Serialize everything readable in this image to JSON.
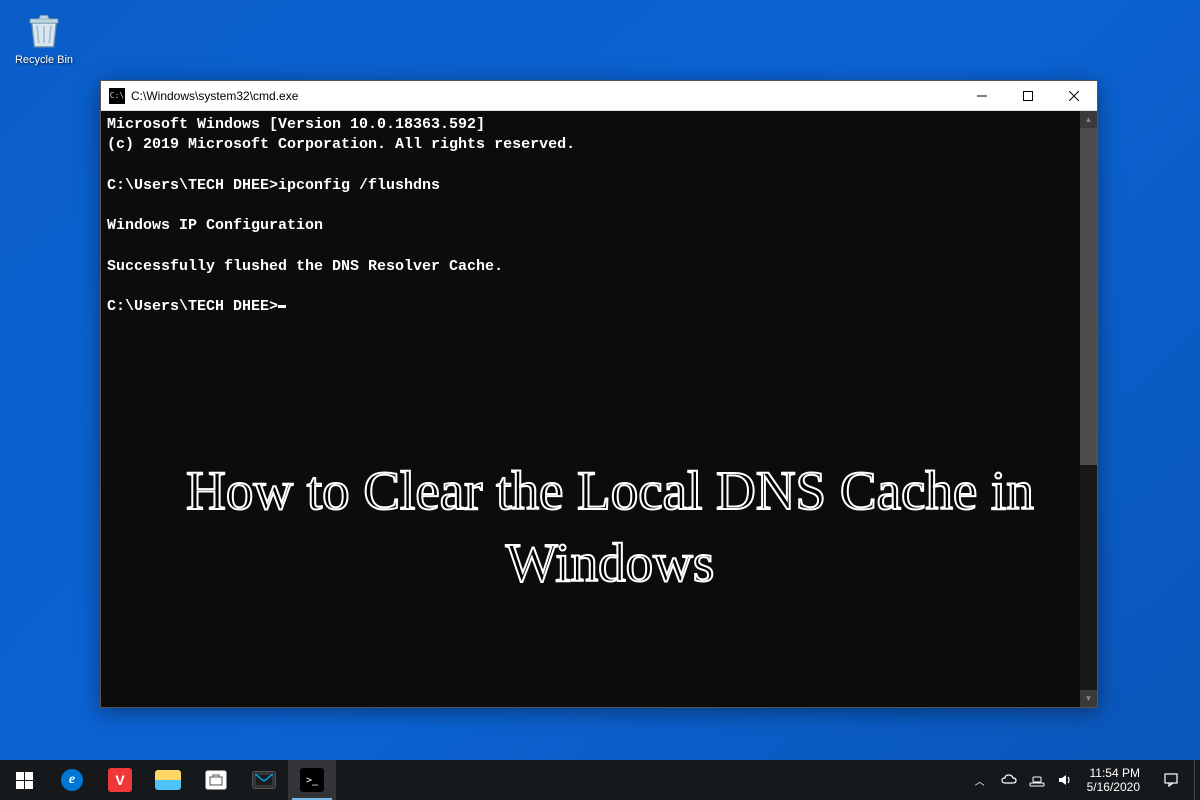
{
  "desktop": {
    "recycle_bin_label": "Recycle Bin"
  },
  "cmd": {
    "title": "C:\\Windows\\system32\\cmd.exe",
    "lines": {
      "version": "Microsoft Windows [Version 10.0.18363.592]",
      "copyright": "(c) 2019 Microsoft Corporation. All rights reserved.",
      "prompt1": "C:\\Users\\TECH DHEE>",
      "command": "ipconfig /flushdns",
      "heading": "Windows IP Configuration",
      "result": "Successfully flushed the DNS Resolver Cache.",
      "prompt2": "C:\\Users\\TECH DHEE>"
    },
    "icon_text": "C:\\"
  },
  "overlay": {
    "text": "How to Clear the Local DNS Cache in Windows"
  },
  "taskbar": {
    "apps": {
      "start": "Start",
      "edge": "Edge",
      "vivaldi": "Vivaldi",
      "explorer": "File Explorer",
      "store": "Microsoft Store",
      "mail": "Mail",
      "cmd": "Command Prompt"
    },
    "clock": {
      "time": "11:54 PM",
      "date": "5/16/2020"
    }
  }
}
